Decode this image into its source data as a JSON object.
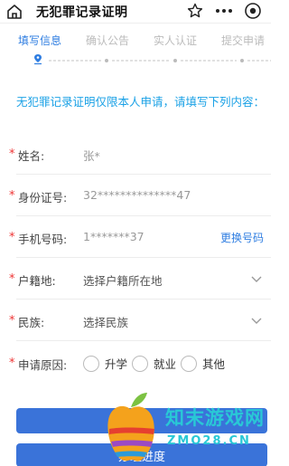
{
  "header": {
    "title": "无犯罪记录证明"
  },
  "steps": [
    {
      "label": "填写信息",
      "active": true
    },
    {
      "label": "确认公告",
      "active": false
    },
    {
      "label": "实人认证",
      "active": false
    },
    {
      "label": "提交申请",
      "active": false
    }
  ],
  "notice": "无犯罪记录证明仅限本人申请，请填写下列内容：",
  "form": {
    "name": {
      "label": "姓名:",
      "value": "张*"
    },
    "id_number": {
      "label": "身份证号:",
      "value": "32**************47"
    },
    "phone": {
      "label": "手机号码:",
      "value": "1*******37",
      "action": "更换号码"
    },
    "household": {
      "label": "户籍地:",
      "placeholder": "选择户籍所在地"
    },
    "ethnicity": {
      "label": "民族:",
      "placeholder": "选择民族"
    },
    "reason": {
      "label": "申请原因:",
      "options": [
        "升学",
        "就业",
        "其他"
      ]
    }
  },
  "buttons": {
    "next": "",
    "progress": "办理进度"
  },
  "watermark": {
    "cn": "知末游戏网",
    "en": "ZMO28.CN"
  },
  "colors": {
    "accent": "#2e7de1",
    "notice": "#1aa1e6",
    "required": "#ee3333",
    "button": "#3a73d9"
  }
}
